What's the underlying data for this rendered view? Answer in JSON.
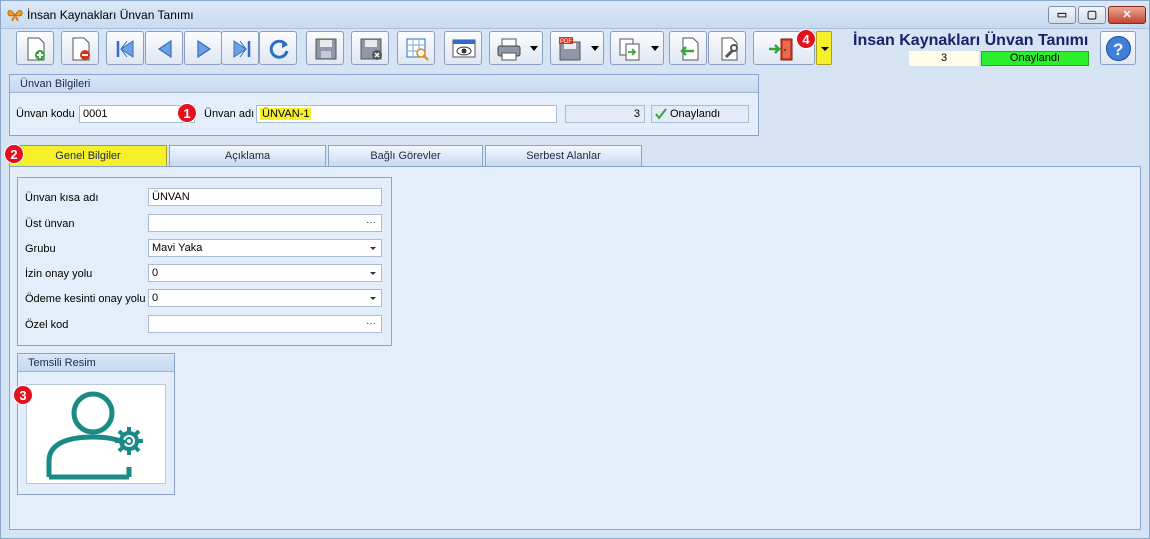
{
  "window": {
    "title": "İnsan Kaynakları Ünvan Tanımı",
    "controls": {
      "minimize": "▭",
      "maximize": "▢",
      "close": "✕"
    }
  },
  "header": {
    "title": "İnsan Kaynakları Ünvan Tanımı",
    "count": "3",
    "status": "Onaylandı",
    "status_color": "#2bef2b"
  },
  "toolbar": {
    "icons": [
      "new-document-icon",
      "delete-document-icon",
      "first-record-icon",
      "previous-record-icon",
      "next-record-icon",
      "last-record-icon",
      "refresh-icon",
      "save-icon",
      "cancel-save-icon",
      "table-search-icon",
      "preview-icon",
      "print-icon",
      "pdf-export-icon",
      "copy-document-icon",
      "import-icon",
      "tools-icon",
      "exit-icon",
      "help-icon"
    ]
  },
  "badges": {
    "b1": "1",
    "b2": "2",
    "b3": "3",
    "b4": "4"
  },
  "unvan_bilgileri": {
    "heading": "Ünvan Bilgileri",
    "code_label": "Ünvan kodu",
    "code_value": "0001",
    "name_label": "Ünvan adı",
    "name_value": "ÜNVAN-1",
    "count_value": "3",
    "approved_label": "Onaylandı"
  },
  "tabs": [
    {
      "label": "Genel Bilgiler",
      "active": true
    },
    {
      "label": "Açıklama",
      "active": false
    },
    {
      "label": "Bağlı Görevler",
      "active": false
    },
    {
      "label": "Serbest Alanlar",
      "active": false
    }
  ],
  "genel": {
    "fields": [
      {
        "label": "Ünvan kısa adı",
        "value": "ÜNVAN",
        "kind": "text"
      },
      {
        "label": "Üst ünvan",
        "value": "",
        "kind": "lookup"
      },
      {
        "label": "Grubu",
        "value": "Mavi Yaka",
        "kind": "combo"
      },
      {
        "label": "İzin onay yolu",
        "value": "0",
        "kind": "combo"
      },
      {
        "label": "Ödeme kesinti onay yolu",
        "value": "0",
        "kind": "combo"
      },
      {
        "label": "Özel kod",
        "value": "",
        "kind": "lookup"
      }
    ],
    "ellipsis": "···"
  },
  "temsili_resim": {
    "heading": "Temsili Resim",
    "image": "user-settings-icon",
    "accent": "#1a8a85"
  }
}
